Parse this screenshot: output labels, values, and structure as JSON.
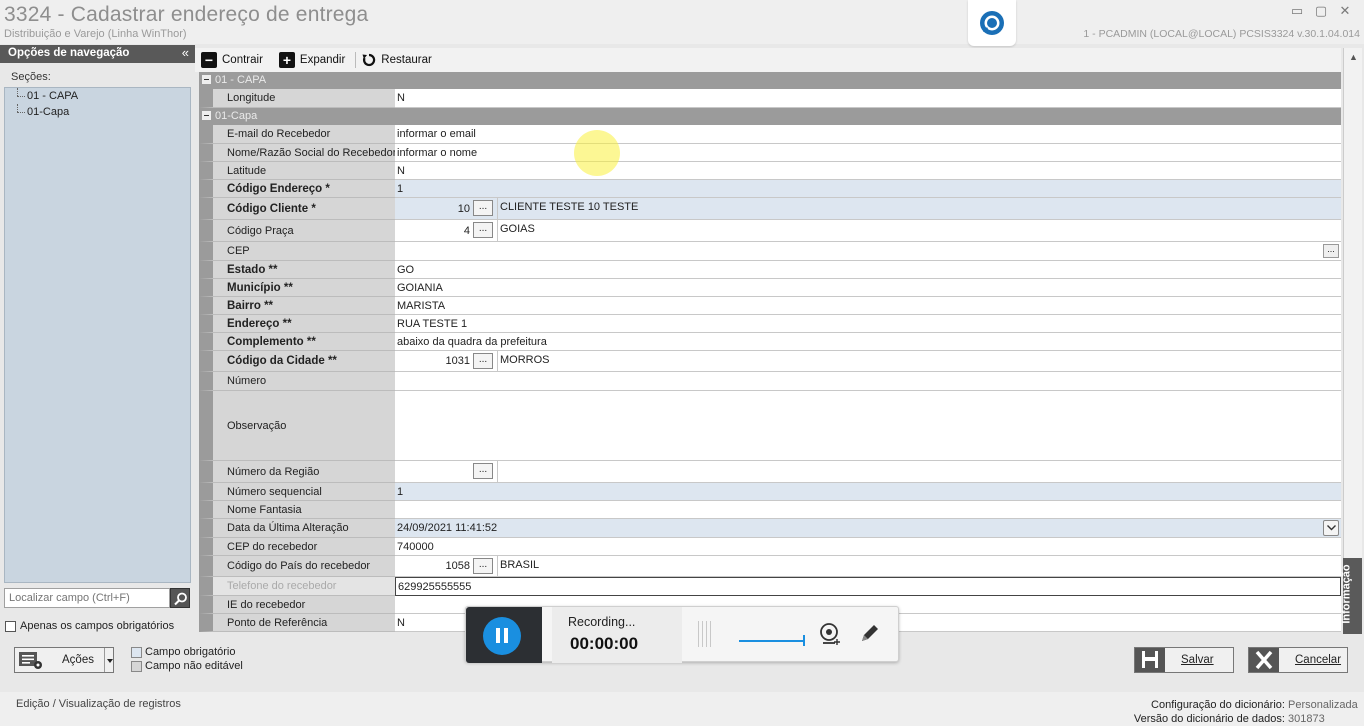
{
  "window": {
    "title": "3324 - Cadastrar endereço de entrega",
    "subtitle": "Distribuição e Varejo (Linha WinThor)",
    "system_info": "1 - PCADMIN (LOCAL@LOCAL)   PCSIS3324   v.30.1.04.014",
    "min": "▭",
    "restore": "▢",
    "close": "✕"
  },
  "nav": {
    "header": "Opções de navegação",
    "collapse": "«",
    "sections_label": "Seções:",
    "items": [
      "01 - CAPA",
      "01-Capa"
    ],
    "search_placeholder": "Localizar campo (Ctrl+F)",
    "only_required": "Apenas os campos obrigatórios"
  },
  "toolbar": {
    "collapse": "Contrair",
    "expand": "Expandir",
    "restore": "Restaurar"
  },
  "grid": {
    "cat1": "01 - CAPA",
    "cat2": "01-Capa",
    "rows": {
      "longitude": {
        "label": "Longitude",
        "value": "N"
      },
      "email": {
        "label": "E-mail do Recebedor",
        "value": "informar o email"
      },
      "nome": {
        "label": "Nome/Razão Social do Recebedor",
        "value": "informar o nome"
      },
      "latitude": {
        "label": "Latitude",
        "value": "N"
      },
      "cod_endereco": {
        "label": "Código Endereço *",
        "value": "1"
      },
      "cod_cliente": {
        "label": "Código Cliente  *",
        "code": "10",
        "desc": "CLIENTE TESTE 10 TESTE"
      },
      "cod_praca": {
        "label": "Código Praça",
        "code": "4",
        "desc": "GOIAS"
      },
      "cep": {
        "label": "CEP",
        "value": ""
      },
      "estado": {
        "label": "Estado **",
        "value": "GO"
      },
      "municipio": {
        "label": "Município **",
        "value": "GOIANIA"
      },
      "bairro": {
        "label": "Bairro **",
        "value": "MARISTA"
      },
      "endereco": {
        "label": "Endereço **",
        "value": "RUA TESTE 1"
      },
      "complemento": {
        "label": "Complemento **",
        "value": "abaixo da quadra da prefeitura"
      },
      "cod_cidade": {
        "label": "Código da Cidade **",
        "code": "1031",
        "desc": "MORROS"
      },
      "numero": {
        "label": "Número",
        "value": ""
      },
      "observacao": {
        "label": "Observação",
        "value": ""
      },
      "num_regiao": {
        "label": "Número da Região",
        "code": "",
        "desc": ""
      },
      "num_seq": {
        "label": "Número sequencial",
        "value": "1"
      },
      "fantasia": {
        "label": "Nome Fantasia",
        "value": ""
      },
      "data_alt": {
        "label": "Data da Última Alteração",
        "value": "24/09/2021 11:41:52"
      },
      "cep_receb": {
        "label": "CEP do recebedor",
        "value": "740000"
      },
      "cod_pais": {
        "label": "Código do País do recebedor",
        "code": "1058",
        "desc": "BRASIL"
      },
      "telefone": {
        "label": "Telefone do recebedor",
        "value": "629925555555"
      },
      "ie": {
        "label": "IE do recebedor",
        "value": ""
      },
      "ponto_ref": {
        "label": "Ponto de Referência",
        "value": "N"
      }
    },
    "dots": "..."
  },
  "info_tab": "Informação",
  "actions": {
    "acoes": "Ações",
    "legend_required": "Campo obrigatório",
    "legend_not_editable": "Campo não editável",
    "save": "Salvar",
    "cancel": "Cancelar"
  },
  "recorder": {
    "status": "Recording...",
    "time": "00:00:00"
  },
  "status": {
    "mode": "Edição / Visualização de registros",
    "dict_config_label": "Configuração do dicionário:",
    "dict_config_value": "Personalizada",
    "dict_version_label": "Versão do dicionário de dados:",
    "dict_version_value": "301873"
  },
  "colors": {
    "accent": "#1a8fe0",
    "required_field": "#dde6f0",
    "readonly_field": "#d6d6d6",
    "category": "#9b9b9b"
  }
}
